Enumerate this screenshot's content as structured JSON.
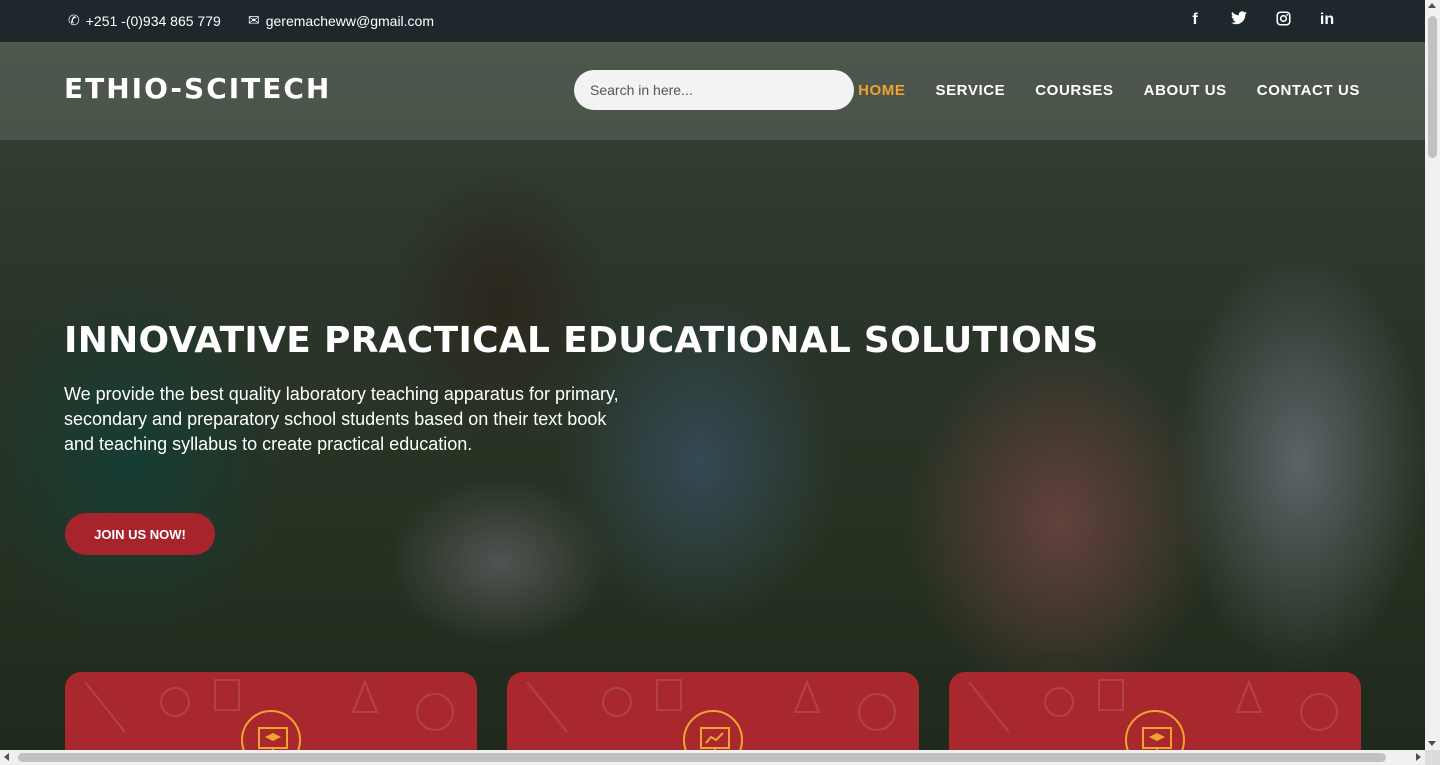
{
  "topbar": {
    "phone": "+251 -(0)934 865 779",
    "email": "geremacheww@gmail.com",
    "socials": [
      {
        "name": "facebook",
        "glyph": "f"
      },
      {
        "name": "twitter",
        "glyph": "t"
      },
      {
        "name": "instagram",
        "glyph": "◎"
      },
      {
        "name": "linkedin",
        "glyph": "in"
      }
    ]
  },
  "header": {
    "logo": "ETHIO-SCITECH",
    "search_placeholder": "Search in here...",
    "nav": [
      "HOME",
      "SERVICE",
      "COURSES",
      "ABOUT US",
      "CONTACT US"
    ],
    "active_nav": "HOME"
  },
  "hero": {
    "headline": "INNOVATIVE PRACTICAL EDUCATIONAL SOLUTIONS",
    "subtext": "We provide the best quality laboratory teaching apparatus for primary, secondary and preparatory school students based on their text book and teaching syllabus to create practical education.",
    "cta": "JOIN US NOW!"
  },
  "cards": [
    {
      "icon": "graduation-board-icon"
    },
    {
      "icon": "presentation-board-icon"
    },
    {
      "icon": "graduation-board-icon"
    }
  ],
  "colors": {
    "accent": "#f0a330",
    "brand_red": "#a8242c",
    "topbar": "#1e272c"
  }
}
